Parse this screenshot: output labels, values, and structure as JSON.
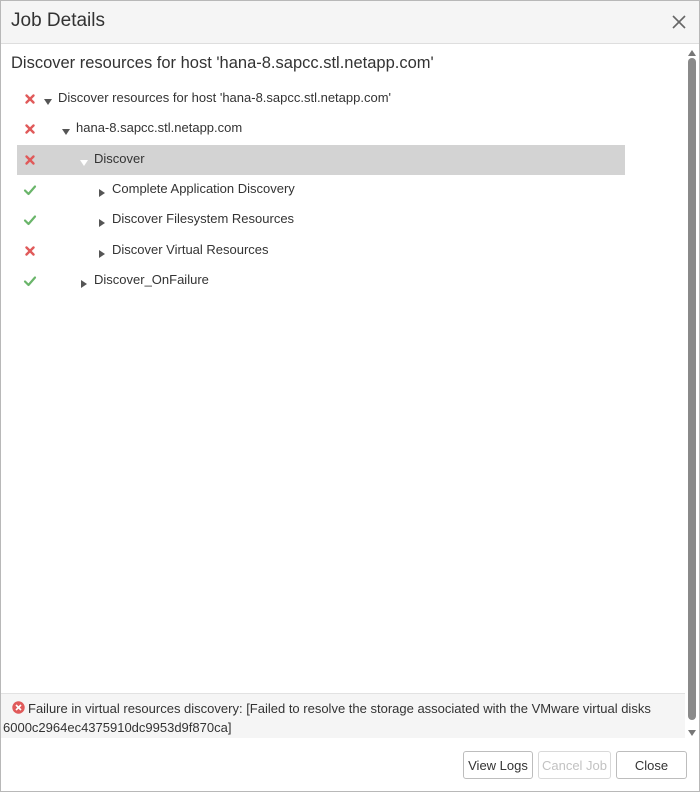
{
  "dialog": {
    "title": "Job Details"
  },
  "main": {
    "heading": "Discover resources for host 'hana-8.sapcc.stl.netapp.com'"
  },
  "tree": [
    {
      "label": "Discover resources for host 'hana-8.sapcc.stl.netapp.com'",
      "status": "failed",
      "expander": "expanded",
      "level": 0,
      "selected": false
    },
    {
      "label": "hana-8.sapcc.stl.netapp.com",
      "status": "failed",
      "expander": "expanded",
      "level": 1,
      "selected": false
    },
    {
      "label": "Discover",
      "status": "failed",
      "expander": "expanded",
      "level": 2,
      "selected": true
    },
    {
      "label": "Complete Application Discovery",
      "status": "success",
      "expander": "collapsed",
      "level": 3,
      "selected": false
    },
    {
      "label": "Discover Filesystem Resources",
      "status": "success",
      "expander": "collapsed",
      "level": 3,
      "selected": false
    },
    {
      "label": "Discover Virtual Resources",
      "status": "failed",
      "expander": "collapsed",
      "level": 3,
      "selected": false
    },
    {
      "label": "Discover_OnFailure",
      "status": "success",
      "expander": "collapsed",
      "level": 2,
      "selected": false
    }
  ],
  "error": {
    "message": "Failure in virtual resources discovery: [Failed to resolve the storage associated with the VMware virtual disks 6000c2964ec4375910dc9953d9f870ca]"
  },
  "footer": {
    "view_logs_label": "View Logs",
    "cancel_job_label": "Cancel Job",
    "close_label": "Close"
  },
  "colors": {
    "failed": "#e05a5a",
    "success": "#6ab56a",
    "selected_row": "#d3d3d3",
    "error_icon": "#e05a5a"
  }
}
